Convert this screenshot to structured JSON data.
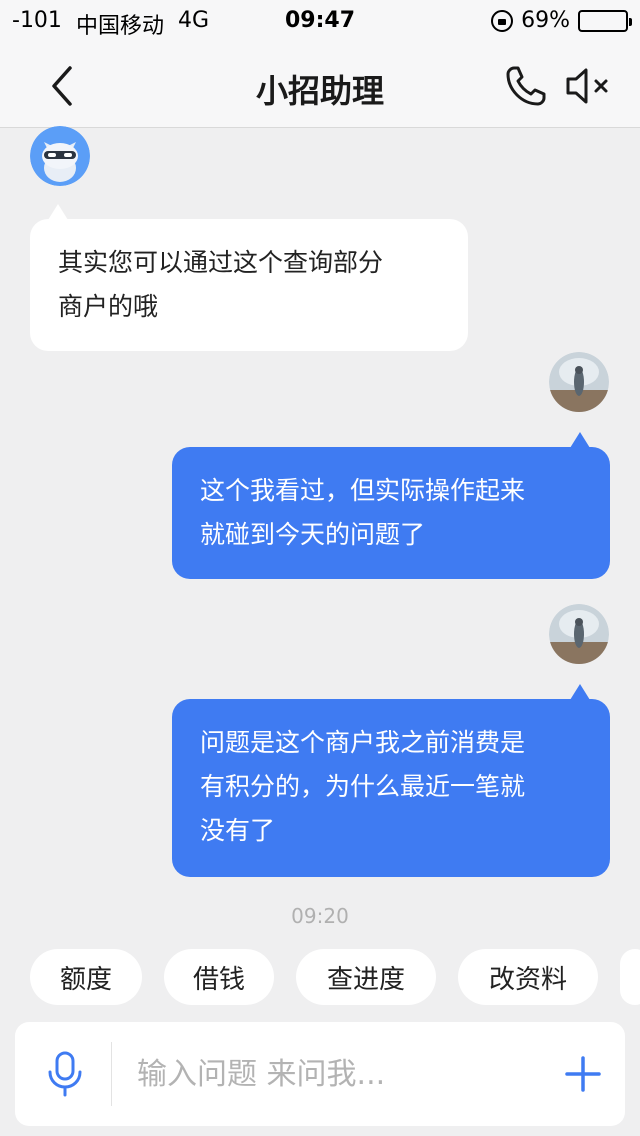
{
  "status_bar": {
    "signal": "-101",
    "carrier": "中国移动",
    "network": "4G",
    "time": "09:47",
    "battery": "69%",
    "battery_level": 0.69
  },
  "nav": {
    "title": "小招助理"
  },
  "messages": [
    {
      "side": "left",
      "text_lines": [
        "其实您可以通过这个查询部分",
        "商户的哦"
      ]
    },
    {
      "side": "right",
      "text_lines": [
        "这个我看过，但实际操作起来",
        "就碰到今天的问题了"
      ]
    },
    {
      "side": "right",
      "text_lines": [
        "问题是这个商户我之前消费是",
        "有积分的，为什么最近一笔就",
        "没有了"
      ]
    }
  ],
  "timestamp": "09:20",
  "quick_chips": [
    "额度",
    "借钱",
    "查进度",
    "改资料"
  ],
  "input": {
    "placeholder": "输入问题 来问我..."
  },
  "colors": {
    "accent": "#3f7bf2",
    "background": "#efeff0",
    "bubble_left": "#ffffff"
  }
}
